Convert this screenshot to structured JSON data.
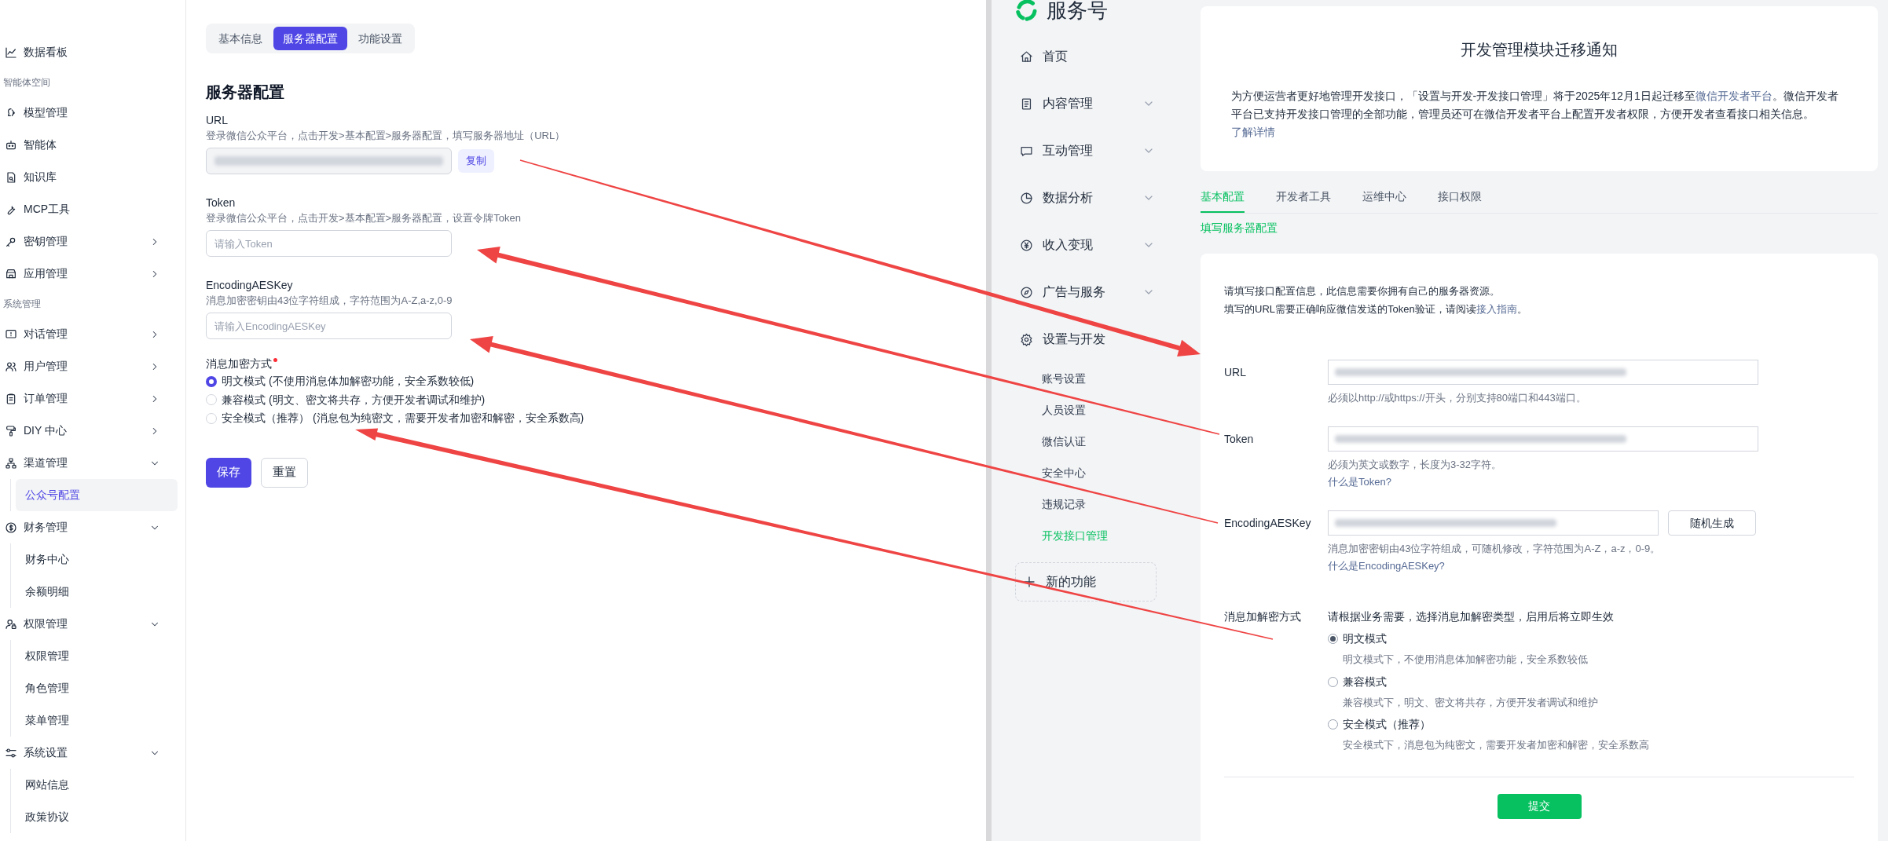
{
  "left_app": {
    "sidebar": {
      "items": [
        {
          "kind": "item",
          "label": "数据看板",
          "selected": false
        },
        {
          "kind": "section",
          "label": "智能体空间"
        },
        {
          "kind": "item",
          "label": "模型管理",
          "selected": false
        },
        {
          "kind": "item",
          "label": "智能体",
          "selected": false
        },
        {
          "kind": "item",
          "label": "知识库",
          "selected": false
        },
        {
          "kind": "item",
          "label": "MCP工具",
          "selected": false
        },
        {
          "kind": "item",
          "label": "密钥管理",
          "selected": false,
          "expanded": false
        },
        {
          "kind": "item",
          "label": "应用管理",
          "selected": false,
          "expanded": false
        },
        {
          "kind": "section",
          "label": "系统管理"
        },
        {
          "kind": "item",
          "label": "对话管理",
          "selected": false,
          "expanded": false
        },
        {
          "kind": "item",
          "label": "用户管理",
          "selected": false,
          "expanded": false
        },
        {
          "kind": "item",
          "label": "订单管理",
          "selected": false,
          "expanded": false
        },
        {
          "kind": "item",
          "label": "DIY 中心",
          "selected": false,
          "expanded": false
        },
        {
          "kind": "item",
          "label": "渠道管理",
          "selected": false,
          "expanded": true,
          "children": [
            {
              "label": "公众号配置",
              "selected": true
            }
          ]
        },
        {
          "kind": "item",
          "label": "财务管理",
          "selected": false,
          "expanded": true,
          "children": [
            {
              "label": "财务中心",
              "selected": false
            },
            {
              "label": "余额明细",
              "selected": false
            }
          ]
        },
        {
          "kind": "item",
          "label": "权限管理",
          "selected": false,
          "expanded": true,
          "children": [
            {
              "label": "权限管理",
              "selected": false
            },
            {
              "label": "角色管理",
              "selected": false
            },
            {
              "label": "菜单管理",
              "selected": false
            }
          ]
        },
        {
          "kind": "item",
          "label": "系统设置",
          "selected": false,
          "expanded": true,
          "children": [
            {
              "label": "网站信息",
              "selected": false
            },
            {
              "label": "政策协议",
              "selected": false
            }
          ]
        }
      ]
    },
    "tabs": [
      {
        "label": "基本信息",
        "selected": false
      },
      {
        "label": "服务器配置",
        "selected": true
      },
      {
        "label": "功能设置",
        "selected": false
      }
    ],
    "heading": "服务器配置",
    "fields": [
      {
        "label": "URL",
        "description": "登录微信公众平台，点击开发>基本配置>服务器配置，填写服务器地址（URL）",
        "kind": "readonly",
        "value_masked": true,
        "button": "复制"
      },
      {
        "label": "Token",
        "description": "登录微信公众平台，点击开发>基本配置>服务器配置，设置令牌Token",
        "kind": "input",
        "placeholder": "请输入Token"
      },
      {
        "label": "EncodingAESKey",
        "description": "消息加密密钥由43位字符组成，字符范围为A-Z,a-z,0-9",
        "kind": "input",
        "placeholder": "请输入EncodingAESKey"
      }
    ],
    "encryption": {
      "label": "消息加密方式",
      "required": true,
      "options": [
        {
          "label": "明文模式 (不使用消息体加解密功能，安全系数较低)",
          "selected": true
        },
        {
          "label": "兼容模式 (明文、密文将共存，方便开发者调试和维护)",
          "selected": false
        },
        {
          "label": "安全模式（推荐） (消息包为纯密文，需要开发者加密和解密，安全系数高)",
          "selected": false
        }
      ]
    },
    "buttons": [
      {
        "label": "保存",
        "kind": "primary"
      },
      {
        "label": "重置",
        "kind": "default"
      }
    ]
  },
  "right_app": {
    "brand": "服务号",
    "nav": [
      {
        "label": "首页",
        "selected": false
      },
      {
        "label": "内容管理",
        "selected": false,
        "expanded": false
      },
      {
        "label": "互动管理",
        "selected": false,
        "expanded": false
      },
      {
        "label": "数据分析",
        "selected": false,
        "expanded": false
      },
      {
        "label": "收入变现",
        "selected": false,
        "expanded": false
      },
      {
        "label": "广告与服务",
        "selected": false,
        "expanded": false
      },
      {
        "label": "设置与开发",
        "selected": false,
        "children": [
          {
            "label": "账号设置",
            "selected": false
          },
          {
            "label": "人员设置",
            "selected": false
          },
          {
            "label": "微信认证",
            "selected": false
          },
          {
            "label": "安全中心",
            "selected": false
          },
          {
            "label": "违规记录",
            "selected": false
          },
          {
            "label": "开发接口管理",
            "selected": true
          }
        ]
      }
    ],
    "new_feature_button": "新的功能",
    "notice": {
      "title": "开发管理模块迁移通知",
      "body": [
        {
          "kind": "text",
          "text": "为方便运营者更好地管理开发接口，「设置与开发-开发接口管理」将于2025年12月1日起迁移至"
        },
        {
          "kind": "link",
          "text": "微信开发者平台"
        },
        {
          "kind": "text",
          "text": "。微信开发者平台已支持开发接口管理的全部功能，管理员还可在微信开发者平台上配置开发者权限，方便开发者查看接口相关信息。"
        },
        {
          "kind": "link",
          "text": "了解详情"
        }
      ]
    },
    "tabs": [
      {
        "label": "基本配置",
        "selected": true
      },
      {
        "label": "开发者工具",
        "selected": false
      },
      {
        "label": "运维中心",
        "selected": false
      },
      {
        "label": "接口权限",
        "selected": false
      }
    ],
    "section_title": "填写服务器配置",
    "intro": [
      [
        {
          "kind": "text",
          "text": "请填写接口配置信息，此信息需要你拥有自己的服务器资源。"
        }
      ],
      [
        {
          "kind": "text",
          "text": "填写的URL需要正确响应微信发送的Token验证，请阅读"
        },
        {
          "kind": "link",
          "text": "接入指南"
        },
        {
          "kind": "text",
          "text": "。"
        }
      ]
    ],
    "fields": [
      {
        "label": "URL",
        "value_masked": true,
        "hint": "必须以http://或https://开头，分别支持80端口和443端口。"
      },
      {
        "label": "Token",
        "value_masked": true,
        "hint": "必须为英文或数字，长度为3-32字符。",
        "help_link": "什么是Token?"
      },
      {
        "label": "EncodingAESKey",
        "value_masked": true,
        "button": "随机生成",
        "hint": "消息加密密钥由43位字符组成，可随机修改，字符范围为A-Z，a-z，0-9。",
        "help_link": "什么是EncodingAESKey?"
      }
    ],
    "encryption": {
      "label": "消息加解密方式",
      "intro": "请根据业务需要，选择消息加解密类型，启用后将立即生效",
      "options": [
        {
          "label": "明文模式",
          "description": "明文模式下，不使用消息体加解密功能，安全系数较低",
          "selected": true
        },
        {
          "label": "兼容模式",
          "description": "兼容模式下，明文、密文将共存，方便开发者调试和维护",
          "selected": false
        },
        {
          "label": "安全模式（推荐）",
          "description": "安全模式下，消息包为纯密文，需要开发者加密和解密，安全系数高",
          "selected": false
        }
      ]
    },
    "submit": "提交"
  }
}
